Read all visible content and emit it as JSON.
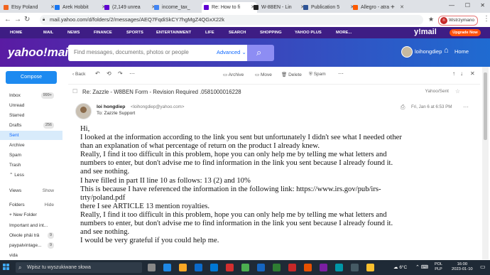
{
  "browser": {
    "tabs": [
      {
        "label": "Etsy Poland",
        "color": "#f1641e"
      },
      {
        "label": "Arek Hobbit",
        "color": "#1877f2"
      },
      {
        "label": "(2,149 unrea",
        "color": "#6001d2"
      },
      {
        "label": "income_tax_",
        "color": "#4285f4"
      },
      {
        "label": "Re: How to fi",
        "color": "#6001d2"
      },
      {
        "label": "W-8BEN - Lin",
        "color": "#222222"
      },
      {
        "label": "Publication 5",
        "color": "#2f5597"
      },
      {
        "label": "Allegro - atra",
        "color": "#ff5a00"
      }
    ],
    "url": "mail.yahoo.com/d/folders/2/messages/AEQ7FqdiSkCY7hgMgZ4QGxX22k",
    "profile_label": "Wstrzymano",
    "profile_initial": "n"
  },
  "yahoo_nav": {
    "items": [
      "HOME",
      "MAIL",
      "NEWS",
      "FINANCE",
      "SPORTS",
      "ENTERTAINMENT",
      "LIFE",
      "SEARCH",
      "SHOPPING",
      "YAHOO PLUS",
      "MORE..."
    ],
    "logo": "y!mail",
    "upgrade_label": "Upgrade Now"
  },
  "header": {
    "logo": "yahoo!mail",
    "search_placeholder": "Find messages, documents, photos or people",
    "advanced_label": "Advanced",
    "username": "loihongdiep",
    "home_label": "Home"
  },
  "sidebar": {
    "compose_label": "Compose",
    "folders": [
      {
        "label": "Inbox",
        "count": "999+"
      },
      {
        "label": "Unread",
        "count": ""
      },
      {
        "label": "Starred",
        "count": ""
      },
      {
        "label": "Drafts",
        "count": "256"
      },
      {
        "label": "Sent",
        "count": "",
        "selected": true
      },
      {
        "label": "Archive",
        "count": ""
      },
      {
        "label": "Spam",
        "count": ""
      },
      {
        "label": "Trash",
        "count": ""
      },
      {
        "label": "⌃ Less",
        "count": ""
      }
    ],
    "views_label": "Views",
    "views_action": "Show",
    "folders_label": "Folders",
    "folders_action": "Hide",
    "new_folder_label": "+ New Folder",
    "custom_folders": [
      {
        "label": "Important and int...",
        "count": ""
      },
      {
        "label": "Oleole phải trả",
        "count": "9"
      },
      {
        "label": "paypalvintage...",
        "count": "9"
      },
      {
        "label": "vida",
        "count": ""
      }
    ]
  },
  "toolbar": {
    "back_label": "Back",
    "archive_label": "Archive",
    "move_label": "Move",
    "delete_label": "Delete",
    "spam_label": "Spam"
  },
  "message": {
    "subject": "Re: Zazzle - W8BEN Form - Revision Required .0581000016228",
    "folder_label": "Yahoo/Sent",
    "from_name": "loi hongdiep",
    "from_email": "<loihongdiep@yahoo.com>",
    "to": "To: Zazzle Support",
    "date": "Fri, Jan 6 at 6:53 PM",
    "body_lines": [
      "Hi,",
      "I looked at the information according to the link you sent but unfortunately I didn't see what I needed other",
      "than an explanation of what percentage of return on the product I already knew.",
      "Really, I find it too difficult in this problem, hope you can only help me by telling me what letters and",
      "numbers to enter, but don't advise me to find information in the link you sent because I already found it.",
      "and see nothing.",
      "I have filled in part II line 10 as follows: 13 (2) and 10%",
      "This is because I have referenced the information in the following link: https://www.irs.gov/pub/irs-",
      "trty/poland.pdf",
      "there I see ARTICLE 13 mention royalties.",
      "Really, I find it too difficult in this problem, hope you can only help me by telling me what letters and",
      "numbers to enter, but don't advise me to find information in the link you sent because I already found it.",
      "and see nothing.",
      "I would be very grateful if you could help me."
    ]
  },
  "taskbar": {
    "search_placeholder": "Wpisz tu wyszukiwane słowa",
    "weather": "6°C",
    "lang_top": "POL",
    "lang_bottom": "PLP",
    "time": "16:00",
    "date": "2023-01-10"
  }
}
